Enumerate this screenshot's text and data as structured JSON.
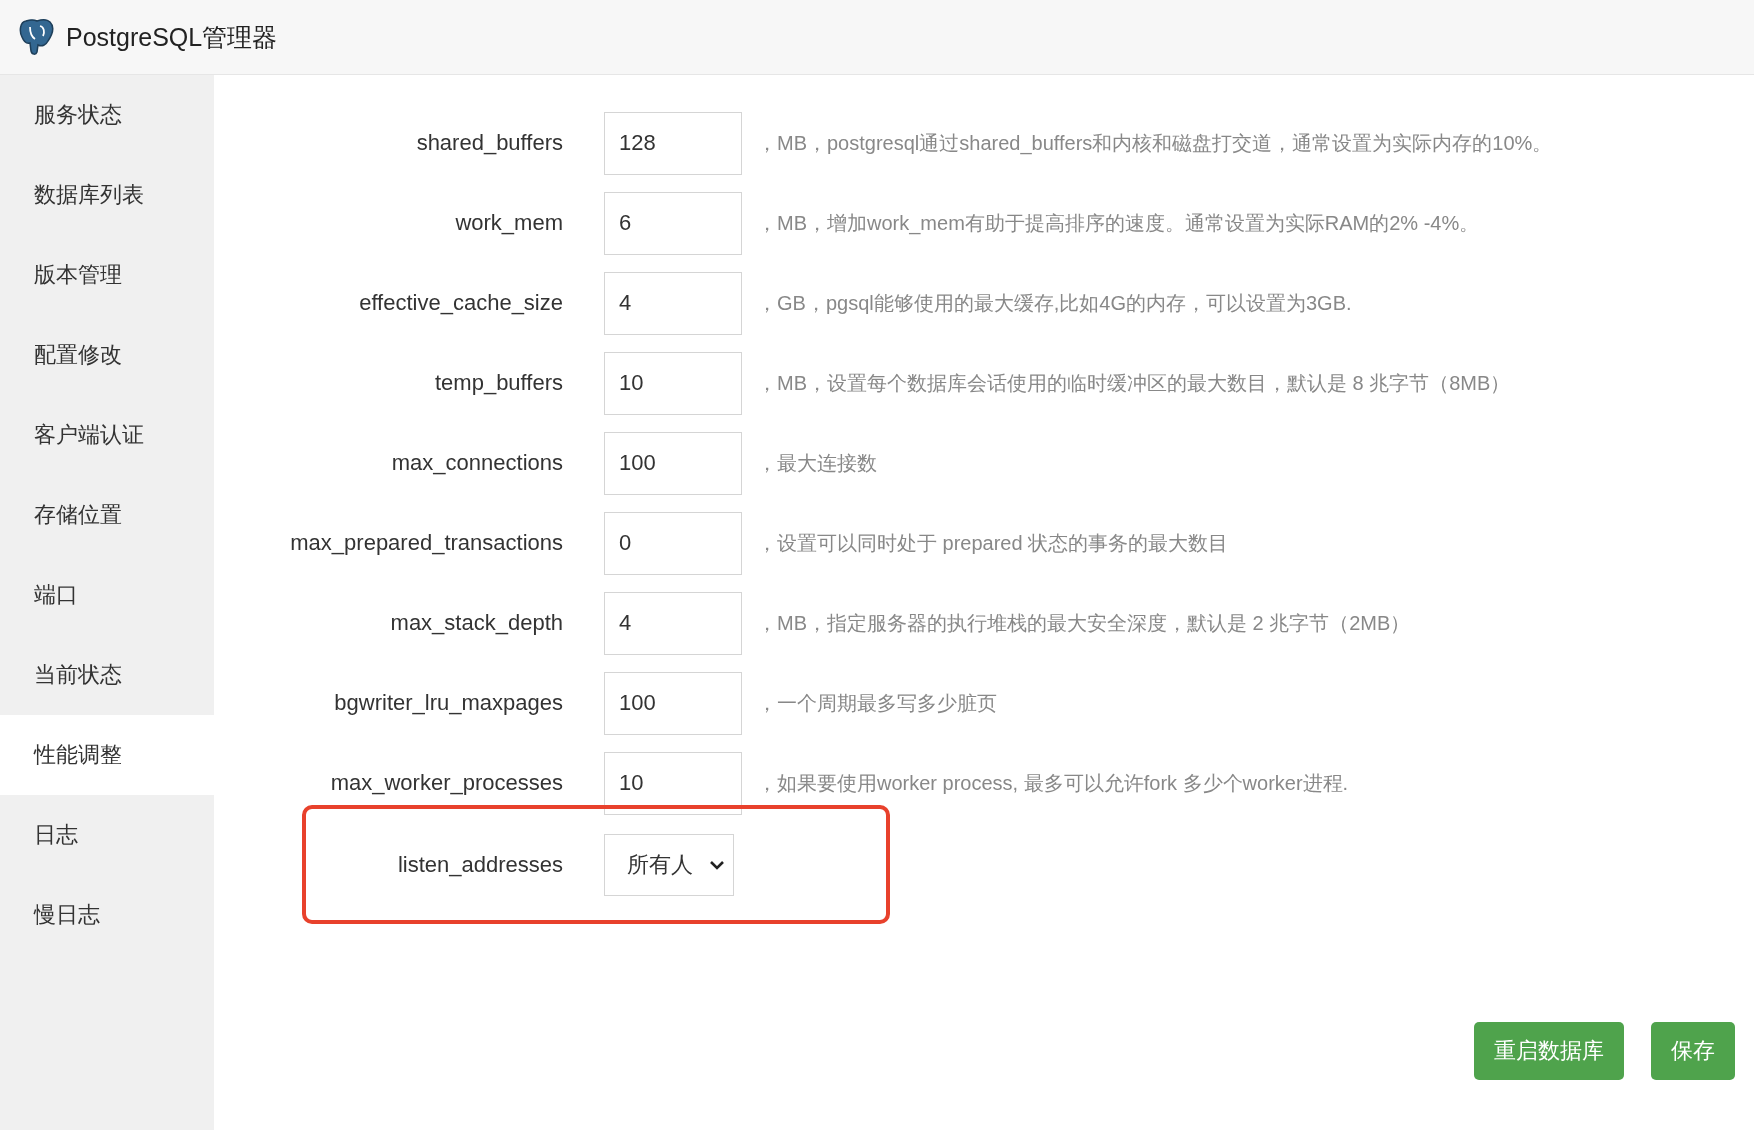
{
  "header": {
    "title": "PostgreSQL管理器"
  },
  "sidebar": {
    "items": [
      {
        "label": "服务状态",
        "selected": false
      },
      {
        "label": "数据库列表",
        "selected": false
      },
      {
        "label": "版本管理",
        "selected": false
      },
      {
        "label": "配置修改",
        "selected": false
      },
      {
        "label": "客户端认证",
        "selected": false
      },
      {
        "label": "存储位置",
        "selected": false
      },
      {
        "label": "端口",
        "selected": false
      },
      {
        "label": "当前状态",
        "selected": false
      },
      {
        "label": "性能调整",
        "selected": true
      },
      {
        "label": "日志",
        "selected": false
      },
      {
        "label": "慢日志",
        "selected": false
      }
    ]
  },
  "settings": [
    {
      "kind": "input",
      "label": "shared_buffers",
      "value": "128",
      "description": "，MB，postgresql通过shared_buffers和内核和磁盘打交道，通常设置为实际内存的10%。",
      "highlighted": false
    },
    {
      "kind": "input",
      "label": "work_mem",
      "value": "6",
      "description": "，MB，增加work_mem有助于提高排序的速度。通常设置为实际RAM的2% -4%。",
      "highlighted": false
    },
    {
      "kind": "input",
      "label": "effective_cache_size",
      "value": "4",
      "description": "，GB，pgsql能够使用的最大缓存,比如4G的内存，可以设置为3GB.",
      "highlighted": false
    },
    {
      "kind": "input",
      "label": "temp_buffers",
      "value": "10",
      "description": "，MB，设置每个数据库会话使用的临时缓冲区的最大数目，默认是 8 兆字节（8MB）",
      "highlighted": false
    },
    {
      "kind": "input",
      "label": "max_connections",
      "value": "100",
      "description": "，最大连接数",
      "highlighted": false
    },
    {
      "kind": "input",
      "label": "max_prepared_transactions",
      "value": "0",
      "description": "，设置可以同时处于 prepared 状态的事务的最大数目",
      "highlighted": false
    },
    {
      "kind": "input",
      "label": "max_stack_depth",
      "value": "4",
      "description": "，MB，指定服务器的执行堆栈的最大安全深度，默认是 2 兆字节（2MB）",
      "highlighted": false
    },
    {
      "kind": "input",
      "label": "bgwriter_lru_maxpages",
      "value": "100",
      "description": "，一个周期最多写多少脏页",
      "highlighted": false
    },
    {
      "kind": "input",
      "label": "max_worker_processes",
      "value": "10",
      "description": "，如果要使用worker process, 最多可以允许fork 多少个worker进程.",
      "highlighted": false
    },
    {
      "kind": "select",
      "label": "listen_addresses",
      "value": "所有人",
      "highlighted": true
    }
  ],
  "buttons": [
    {
      "label": "重启数据库"
    },
    {
      "label": "保存"
    }
  ]
}
